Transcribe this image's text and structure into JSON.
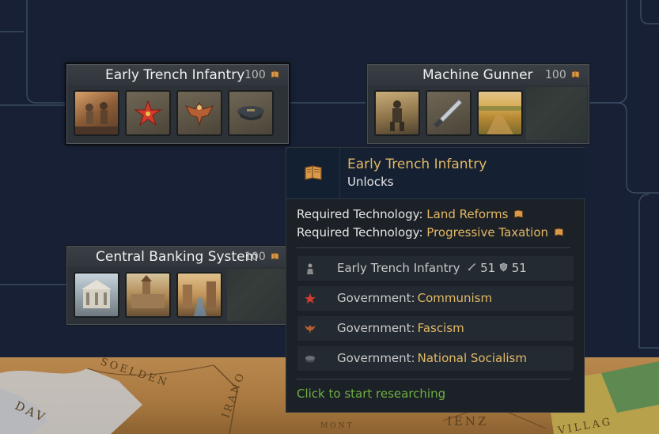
{
  "tech_tree": {
    "cards": [
      {
        "title": "Early Trench Infantry",
        "cost": "100",
        "unlock_icons": [
          "soldiers-charge-icon",
          "communism-star-icon",
          "fascism-eagle-icon",
          "officer-cap-icon"
        ]
      },
      {
        "title": "Machine Gunner",
        "cost": "100",
        "unlock_icons": [
          "machine-gunner-soldier-icon",
          "bayonet-icon",
          "wheat-field-icon"
        ]
      },
      {
        "title": "Central Banking System",
        "cost": "100",
        "unlock_icons": [
          "bank-building-icon",
          "castle-town-icon",
          "city-street-icon"
        ]
      }
    ]
  },
  "tooltip": {
    "title": "Early Trench Infantry",
    "subtitle": "Unlocks",
    "requirements": [
      {
        "label": "Required Technology:",
        "value": "Land Reforms"
      },
      {
        "label": "Required Technology:",
        "value": "Progressive Taxation"
      }
    ],
    "unlocks": [
      {
        "icon": "infantry-icon",
        "label": "Early Trench Infantry",
        "offense": "51",
        "defense": "51"
      },
      {
        "icon": "star-icon",
        "label": "Government:",
        "value": "Communism"
      },
      {
        "icon": "eagle-icon",
        "label": "Government:",
        "value": "Fascism"
      },
      {
        "icon": "cap-icon",
        "label": "Government:",
        "value": "National Socialism"
      }
    ],
    "hint": "Click to start researching"
  },
  "map": {
    "labels": [
      "SOELDEN",
      "DAV",
      "IRANO",
      "IENZ",
      "MONT",
      "VILLAG"
    ]
  },
  "colors": {
    "background": "#172034",
    "gold": "#e3b865",
    "hint_green": "#6fae44"
  }
}
